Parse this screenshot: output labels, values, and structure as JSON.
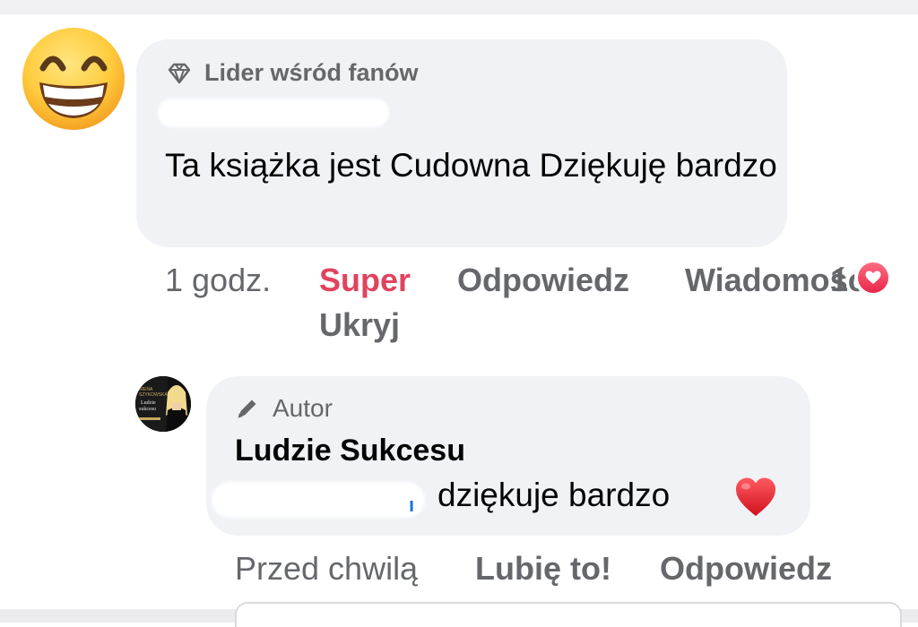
{
  "comment": {
    "badge": "Lider wśród fanów",
    "text": "Ta książka jest Cudowna Dziękuję bardzo",
    "time": "1 godz.",
    "actions": {
      "react": "Super",
      "reply": "Odpowiedz",
      "message": "Wiadomość",
      "hide": "Ukryj"
    },
    "reaction_count": "1",
    "avatar_icon": "grinning-face-emoji",
    "react_color": "#e0435e"
  },
  "reply": {
    "badge": "Autor",
    "author": "Ludzie Sukcesu",
    "tag_fragment": "ı",
    "text": "dziękuje bardzo",
    "emoji": "red-heart",
    "time": "Przed chwilą",
    "actions": {
      "like": "Lubię to!",
      "reply": "Odpowiedz"
    },
    "avatar_lines": [
      "IRENA",
      "SZYKOWSKA",
      "Ludzie",
      "sukcesu"
    ]
  }
}
